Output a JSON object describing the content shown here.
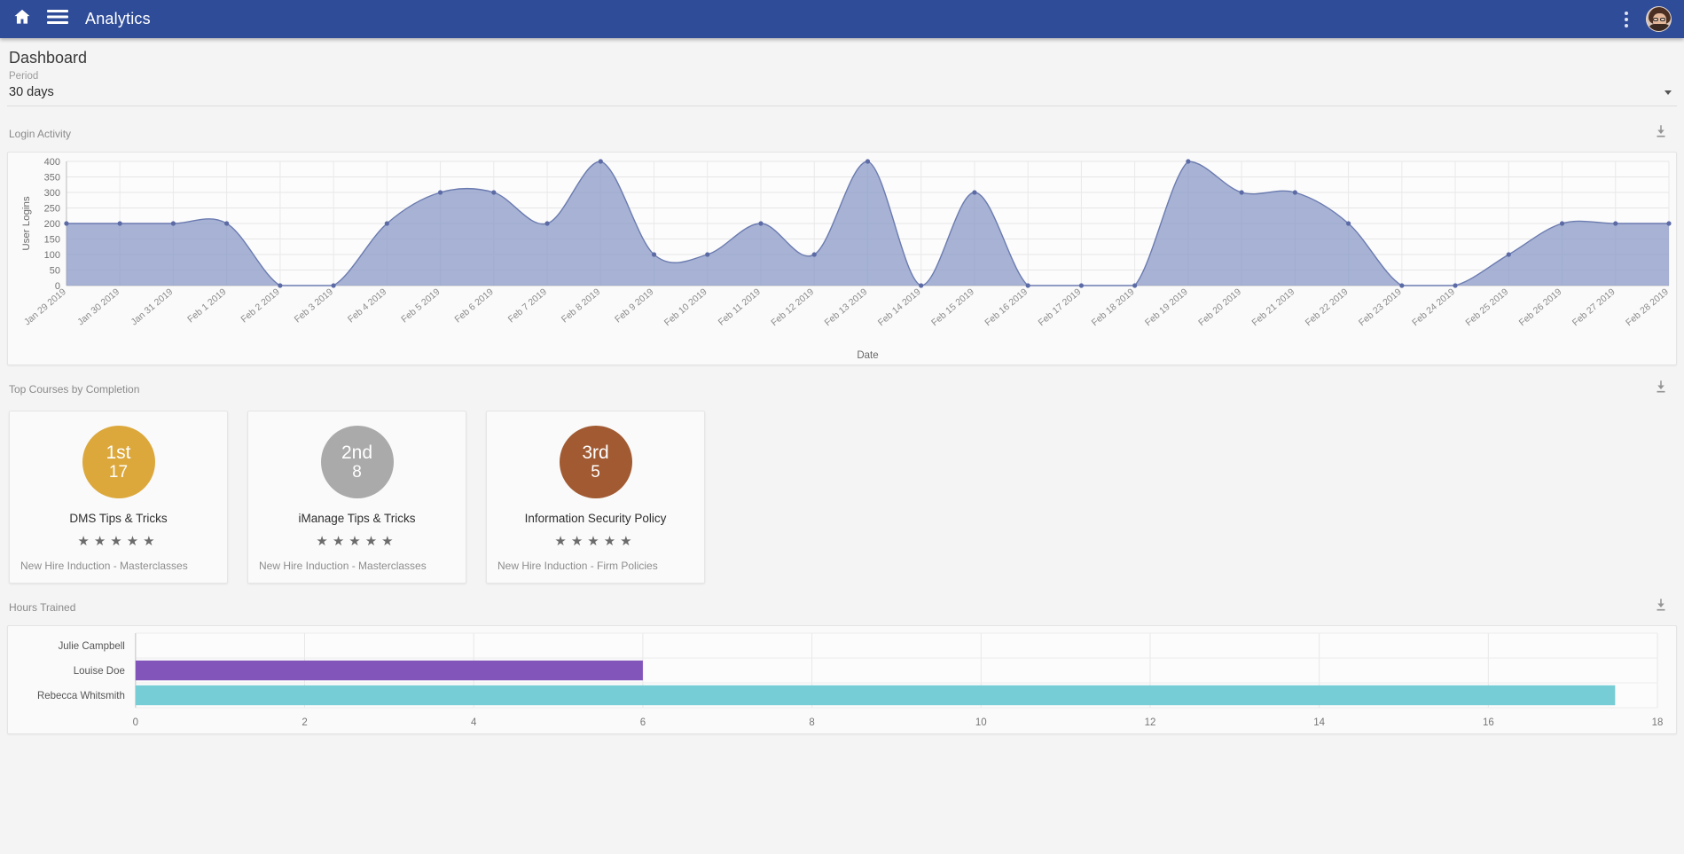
{
  "appbar": {
    "home_icon": "home-icon",
    "menu_icon": "hamburger-menu-icon",
    "title": "Analytics",
    "overflow_icon": "kebab-menu-icon",
    "avatar_alt": "user-avatar"
  },
  "page": {
    "title": "Dashboard"
  },
  "period": {
    "label": "Period",
    "value": "30 days",
    "options": [
      "30 days"
    ],
    "caret_icon": "chevron-down-icon"
  },
  "sections": {
    "login_activity": {
      "title": "Login Activity",
      "download_icon": "download-icon"
    },
    "top_courses": {
      "title": "Top Courses by Completion",
      "download_icon": "download-icon"
    },
    "hours_trained": {
      "title": "Hours Trained",
      "download_icon": "download-icon"
    }
  },
  "courses": [
    {
      "rank": "1st",
      "count": "17",
      "name": "DMS Tips & Tricks",
      "stars": 5,
      "star_glyph": "★",
      "category": "New Hire Induction - Masterclasses",
      "medal_color": "#dca83c"
    },
    {
      "rank": "2nd",
      "count": "8",
      "name": "iManage Tips & Tricks",
      "stars": 5,
      "star_glyph": "★",
      "category": "New Hire Induction - Masterclasses",
      "medal_color": "#aaaaaa"
    },
    {
      "rank": "3rd",
      "count": "5",
      "name": "Information Security Policy",
      "stars": 5,
      "star_glyph": "★",
      "category": "New Hire Induction - Firm Policies",
      "medal_color": "#a15a32"
    }
  ],
  "chart_data": [
    {
      "id": "login-activity",
      "type": "area",
      "title": "Login Activity",
      "xlabel": "Date",
      "ylabel": "User Logins",
      "ylim": [
        0,
        400
      ],
      "yticks": [
        0,
        50,
        100,
        150,
        200,
        250,
        300,
        350,
        400
      ],
      "grid": true,
      "line_color": "#6b7bb0",
      "fill_color": "#8e9cc8",
      "point_color": "#5c6ba6",
      "categories": [
        "Jan 29 2019",
        "Jan 30 2019",
        "Jan 31 2019",
        "Feb 1 2019",
        "Feb 2 2019",
        "Feb 3 2019",
        "Feb 4 2019",
        "Feb 5 2019",
        "Feb 6 2019",
        "Feb 7 2019",
        "Feb 8 2019",
        "Feb 9 2019",
        "Feb 10 2019",
        "Feb 11 2019",
        "Feb 12 2019",
        "Feb 13 2019",
        "Feb 14 2019",
        "Feb 15 2019",
        "Feb 16 2019",
        "Feb 17 2019",
        "Feb 18 2019",
        "Feb 19 2019",
        "Feb 20 2019",
        "Feb 21 2019",
        "Feb 22 2019",
        "Feb 23 2019",
        "Feb 24 2019",
        "Feb 25 2019",
        "Feb 26 2019",
        "Feb 27 2019",
        "Feb 28 2019"
      ],
      "values": [
        200,
        200,
        200,
        200,
        0,
        0,
        200,
        300,
        300,
        200,
        400,
        100,
        100,
        200,
        100,
        400,
        0,
        300,
        0,
        0,
        0,
        400,
        300,
        300,
        200,
        0,
        0,
        100,
        200,
        200,
        200
      ]
    },
    {
      "id": "hours-trained",
      "type": "bar",
      "orientation": "horizontal",
      "title": "Hours Trained",
      "xlabel": "",
      "ylabel": "",
      "xlim": [
        0,
        18
      ],
      "xticks": [
        0,
        2,
        4,
        6,
        8,
        10,
        12,
        14,
        16,
        18
      ],
      "grid": true,
      "categories": [
        "Julie Campbell",
        "Louise Doe",
        "Rebecca Whitsmith"
      ],
      "values": [
        0,
        6,
        17.5
      ],
      "colors": [
        "#f2a0a0",
        "#8255bb",
        "#77cdd6"
      ]
    }
  ]
}
